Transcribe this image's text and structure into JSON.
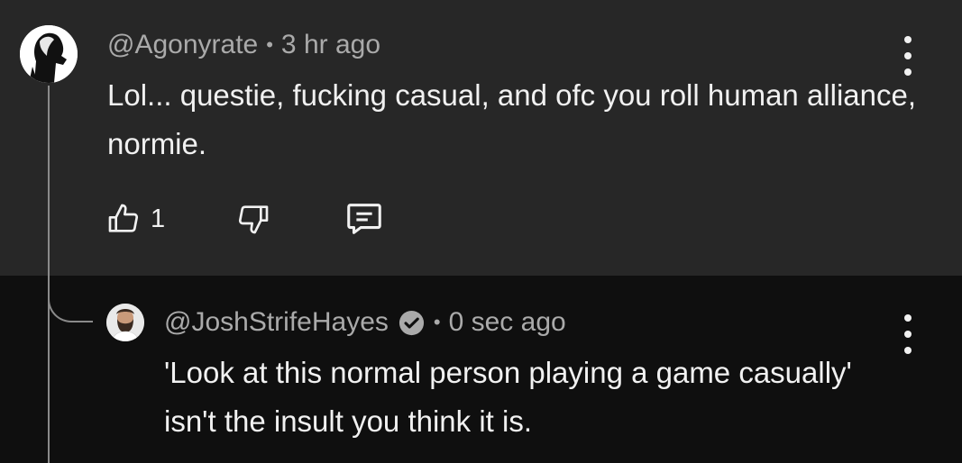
{
  "comments": [
    {
      "handle": "@Agonyrate",
      "separator": "•",
      "time": "3 hr ago",
      "text": "Lol... questie, fucking casual, and ofc you roll human alliance, normie.",
      "likes": "1",
      "avatar_icon": "silhouette-avatar",
      "menu_icon": "more-vert-icon"
    }
  ],
  "reply": {
    "handle": "@JoshStrifeHayes",
    "verified_icon": "verified-check-icon",
    "separator": "•",
    "time": "0 sec ago",
    "text": "'Look at this normal person playing a game casually' isn't the insult you think it is.",
    "avatar_icon": "bearded-man-avatar",
    "menu_icon": "more-vert-icon"
  },
  "colors": {
    "parent_bg": "#272727",
    "reply_bg": "#0f0f0f",
    "text_primary": "#f1f1f1",
    "text_secondary": "#aaaaaa",
    "thread_line": "#8a8a8a"
  }
}
